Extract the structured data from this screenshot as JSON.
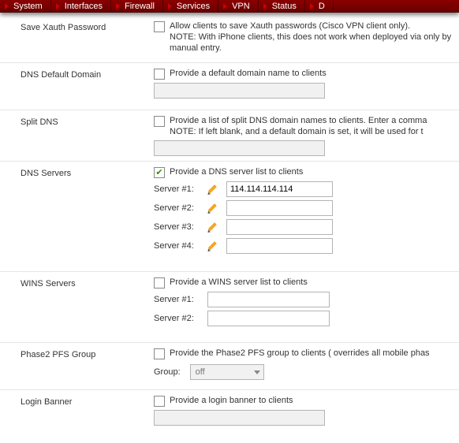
{
  "nav": {
    "items": [
      "System",
      "Interfaces",
      "Firewall",
      "Services",
      "VPN",
      "Status",
      "D"
    ]
  },
  "rows": {
    "xauth": {
      "label": "Save Xauth Password",
      "checked": false,
      "desc": "Allow clients to save Xauth passwords (Cisco VPN client only).\nNOTE: With iPhone clients, this does not work when deployed via only by manual entry."
    },
    "dnsDomain": {
      "label": "DNS Default Domain",
      "checked": false,
      "desc": "Provide a default domain name to clients",
      "value": ""
    },
    "splitDns": {
      "label": "Split DNS",
      "checked": false,
      "desc": "Provide a list of split DNS domain names to clients. Enter a comma\nNOTE: If left blank, and a default domain is set, it will be used for t",
      "value": ""
    },
    "dnsServers": {
      "label": "DNS Servers",
      "checked": true,
      "desc": "Provide a DNS server list to clients",
      "servers": [
        {
          "label": "Server #1:",
          "value": "114.114.114.114"
        },
        {
          "label": "Server #2:",
          "value": ""
        },
        {
          "label": "Server #3:",
          "value": ""
        },
        {
          "label": "Server #4:",
          "value": ""
        }
      ]
    },
    "winsServers": {
      "label": "WINS Servers",
      "checked": false,
      "desc": "Provide a WINS server list to clients",
      "servers": [
        {
          "label": "Server #1:",
          "value": ""
        },
        {
          "label": "Server #2:",
          "value": ""
        }
      ]
    },
    "pfs": {
      "label": "Phase2 PFS Group",
      "checked": false,
      "desc": "Provide the Phase2 PFS group to clients ( overrides all mobile phas",
      "groupLabel": "Group:",
      "groupValue": "off"
    },
    "banner": {
      "label": "Login Banner",
      "checked": false,
      "desc": "Provide a login banner to clients",
      "value": ""
    }
  }
}
